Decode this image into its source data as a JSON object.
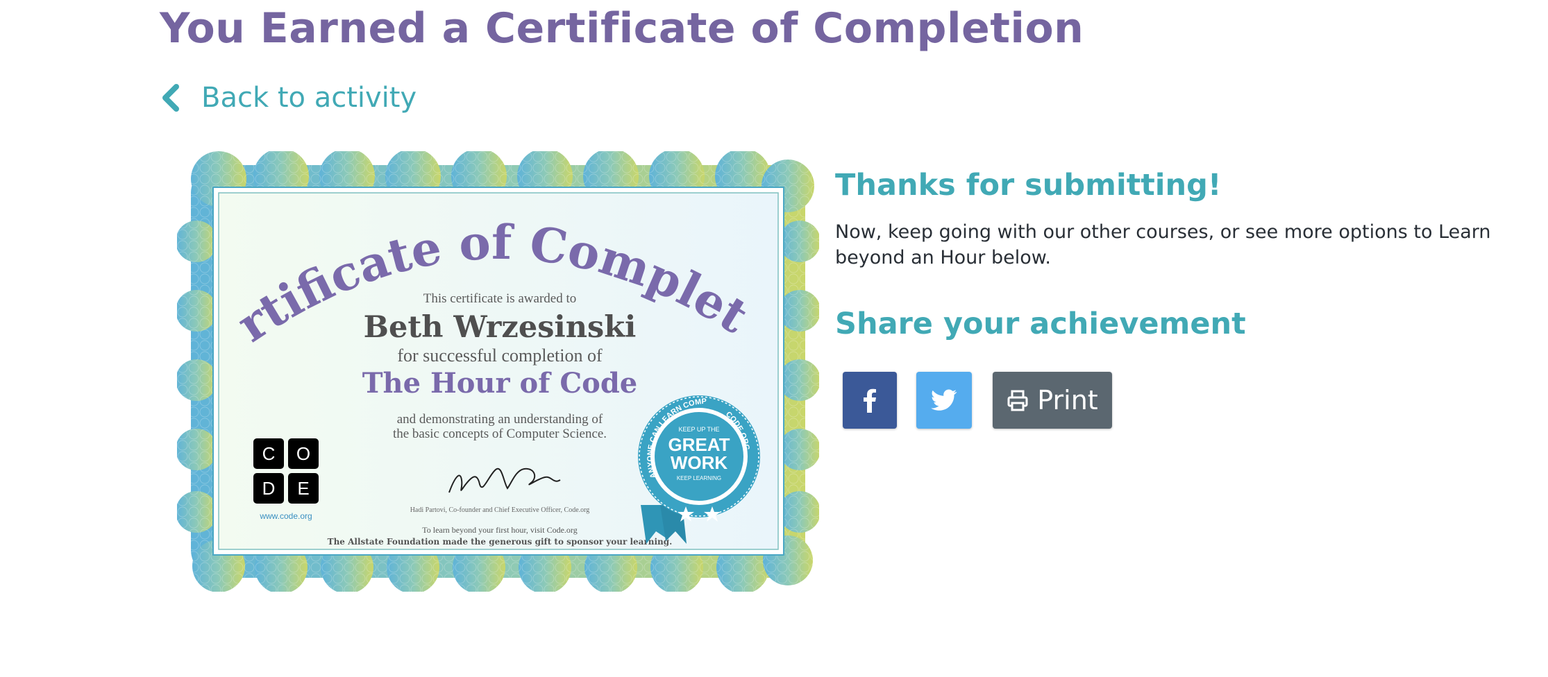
{
  "header": {
    "title": "You Earned a Certificate of Completion"
  },
  "nav": {
    "back_label": "Back to activity",
    "back_icon": "chevron-left-icon"
  },
  "certificate": {
    "heading": "Certificate of Completion",
    "awarded_line": "This certificate is awarded to",
    "recipient": "Beth Wrzesinski",
    "completion_line": "for successful completion of",
    "course": "The Hour of Code",
    "understanding_line1": "and demonstrating an understanding of",
    "understanding_line2": "the basic concepts of Computer Science.",
    "signer": "Hadi Partovi, Co-founder and Chief Executive Officer, Code.org",
    "learn_line": "To learn beyond your first hour, visit Code.org",
    "sponsor_line": "The Allstate Foundation made the generous gift to sponsor your learning.",
    "logo_letters": [
      "C",
      "O",
      "D",
      "E"
    ],
    "logo_url": "www.code.org",
    "badge": {
      "ring_left": "ANYONE CAN LEARN COMPUTER SCIENCE",
      "ring_right": "CODE.ORG",
      "top": "KEEP UP THE",
      "big1": "GREAT",
      "big2": "WORK",
      "bottom": "KEEP LEARNING"
    }
  },
  "thanks": {
    "heading": "Thanks for submitting!",
    "body": "Now, keep going with our other courses, or see more options to Learn beyond an Hour below."
  },
  "share": {
    "heading": "Share your achievement",
    "facebook_icon": "facebook-icon",
    "twitter_icon": "twitter-icon",
    "print_label": "Print",
    "print_icon": "printer-icon"
  },
  "colors": {
    "title_purple": "#7565a0",
    "teal": "#41a9b5",
    "facebook_blue": "#3b5998",
    "twitter_blue": "#55acee",
    "print_gray": "#5b6770"
  }
}
